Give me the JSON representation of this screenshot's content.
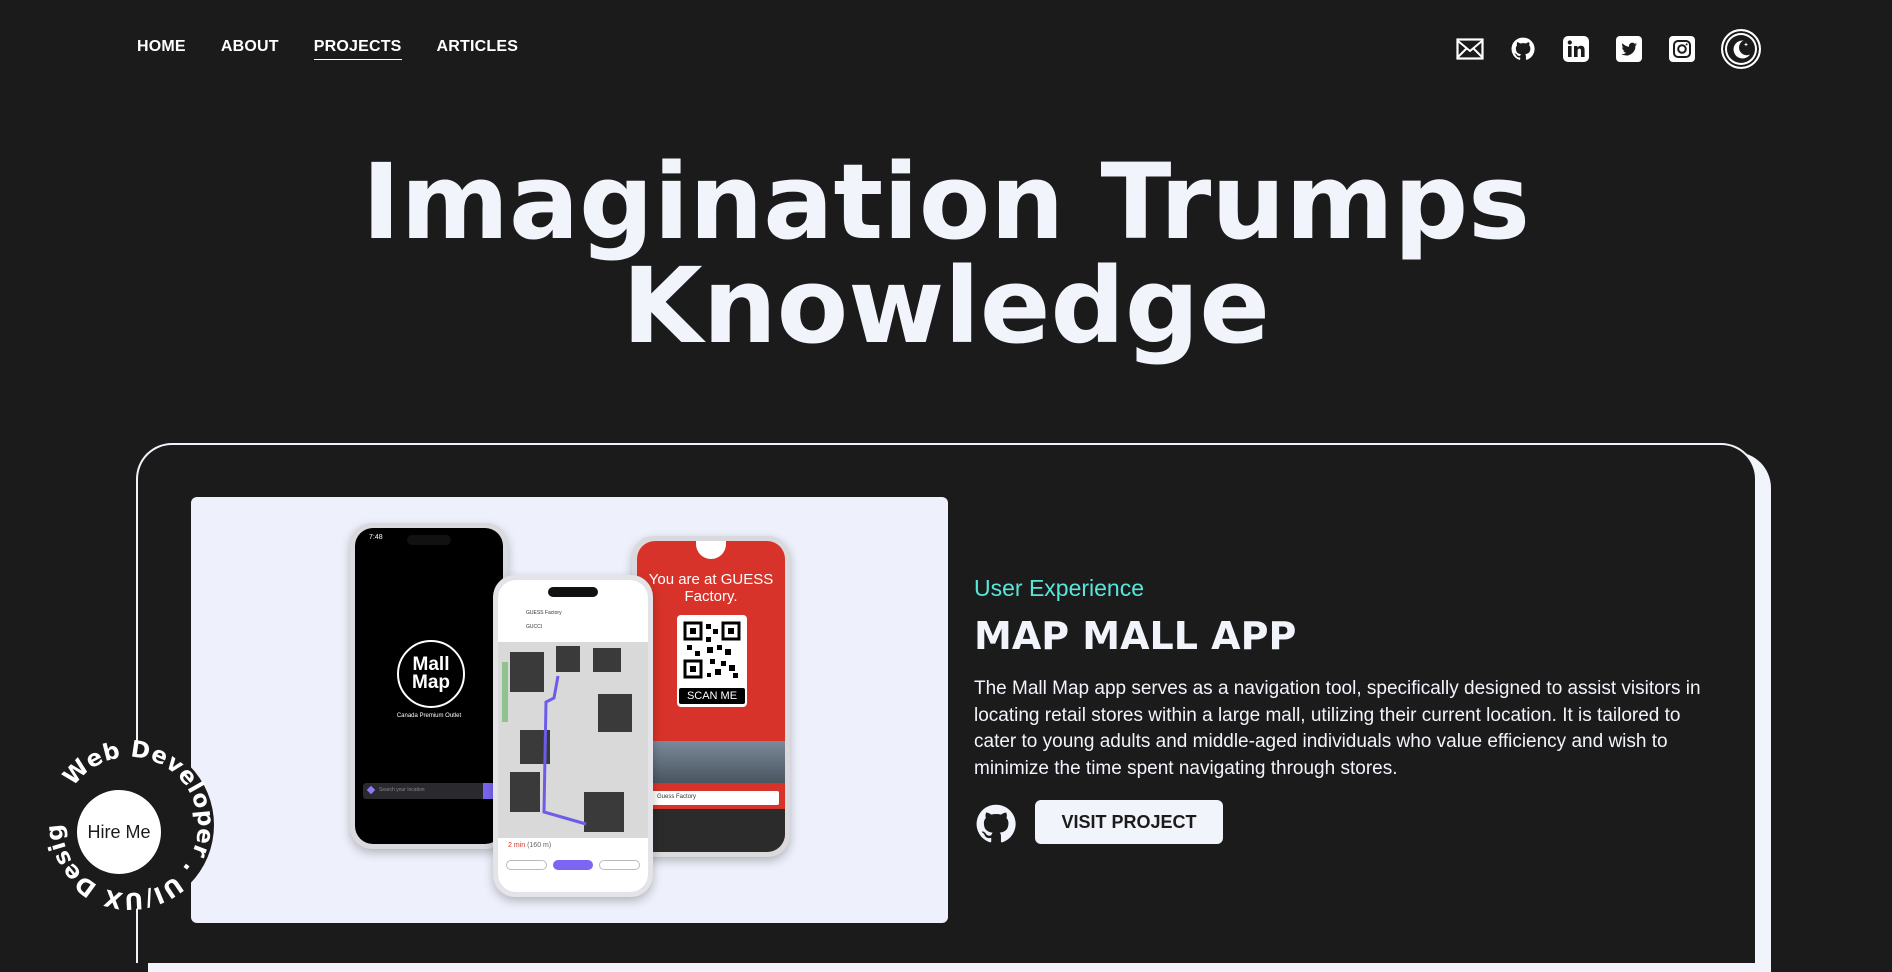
{
  "nav": {
    "links": [
      {
        "label": "HOME"
      },
      {
        "label": "ABOUT"
      },
      {
        "label": "PROJECTS"
      },
      {
        "label": "ARTICLES"
      }
    ],
    "active": "PROJECTS"
  },
  "social": {
    "icons": [
      "mail-icon",
      "github-icon",
      "linkedin-icon",
      "twitter-icon",
      "instagram-icon",
      "moon-icon"
    ]
  },
  "hero": {
    "line1": "Imagination Trumps",
    "line2": "Knowledge"
  },
  "project": {
    "category": "User Experience",
    "title": "MAP MALL APP",
    "description": "The Mall Map app serves as a navigation tool, specifically designed to assist visitors in locating retail stores within a large mall, utilizing their current location. It is tailored to cater to young adults and middle-aged individuals who value efficiency and wish to minimize the time spent navigating through stores.",
    "visit_label": "VISIT PROJECT",
    "mockup": {
      "logo_line1": "Mall",
      "logo_line2": "Map",
      "subtitle": "Canada Premium Outlet",
      "search_placeholder": "Search your location",
      "from": "GUESS Factory",
      "to": "GUCCI",
      "eta": "2 min",
      "eta_distance": "(160 m)",
      "qr_title": "You are at GUESS Factory.",
      "scan_label": "SCAN ME",
      "store_label": "Guess Factory",
      "time": "7:48"
    }
  },
  "hire": {
    "button_label": "Hire Me",
    "ring_text": "Web Developer . UI/UX Designer . "
  },
  "colors": {
    "background": "#1b1b1c",
    "foreground": "#f2f4fb",
    "accent": "#58e6d9"
  }
}
